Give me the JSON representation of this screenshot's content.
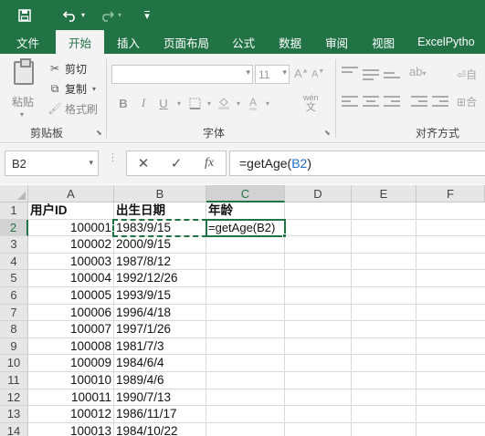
{
  "quick_access": {
    "save_icon": "save-icon",
    "undo_icon": "undo-icon",
    "redo_icon": "redo-icon",
    "customize_icon": "customize-icon"
  },
  "tabs": [
    "文件",
    "开始",
    "插入",
    "页面布局",
    "公式",
    "数据",
    "审阅",
    "视图",
    "ExcelPytho"
  ],
  "active_tab": "开始",
  "ribbon": {
    "clipboard": {
      "paste_label": "粘贴",
      "cut_label": "剪切",
      "copy_label": "复制",
      "format_painter_label": "格式刷",
      "group_label": "剪贴板"
    },
    "font": {
      "font_name": "",
      "font_size": "11",
      "bold": "B",
      "italic": "I",
      "underline": "U",
      "phonetic_top": "wén",
      "phonetic_bottom": "文",
      "group_label": "字体"
    },
    "alignment": {
      "group_label": "对齐方式",
      "wrap_label": "自",
      "merge_label": "合"
    }
  },
  "formula_bar": {
    "name_box": "B2",
    "cancel": "✕",
    "enter": "✓",
    "fx": "fx",
    "formula_prefix": "=getAge(",
    "formula_ref": "B2",
    "formula_suffix": ")"
  },
  "sheet": {
    "columns": [
      "A",
      "B",
      "C",
      "D",
      "E",
      "F"
    ],
    "rows": [
      [
        "用户ID",
        "出生日期",
        "年龄"
      ],
      [
        "100001",
        "1983/9/15",
        "=getAge(B2)"
      ],
      [
        "100002",
        "2000/9/15",
        ""
      ],
      [
        "100003",
        "1987/8/12",
        ""
      ],
      [
        "100004",
        "1992/12/26",
        ""
      ],
      [
        "100005",
        "1993/9/15",
        ""
      ],
      [
        "100006",
        "1996/4/18",
        ""
      ],
      [
        "100007",
        "1997/1/26",
        ""
      ],
      [
        "100008",
        "1981/7/3",
        ""
      ],
      [
        "100009",
        "1984/6/4",
        ""
      ],
      [
        "100010",
        "1989/4/6",
        ""
      ],
      [
        "100011",
        "1990/7/13",
        ""
      ],
      [
        "100012",
        "1986/11/17",
        ""
      ],
      [
        "100013",
        "1984/10/22",
        ""
      ]
    ],
    "row_numbers": [
      "1",
      "2",
      "3",
      "4",
      "5",
      "6",
      "7",
      "8",
      "9",
      "10",
      "11",
      "12",
      "13",
      "14"
    ],
    "active_cell": "C2",
    "copy_range": "B2",
    "accent": "#217346",
    "reference_color": "#1f6fc5"
  }
}
